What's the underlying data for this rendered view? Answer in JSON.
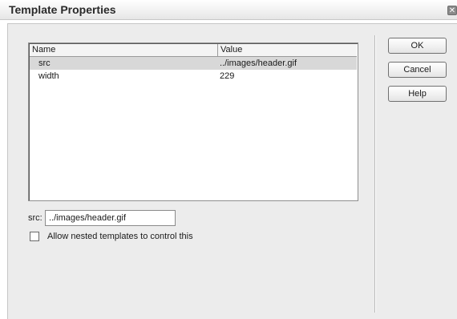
{
  "window": {
    "title": "Template Properties",
    "close_glyph": "✕"
  },
  "list": {
    "columns": [
      "Name",
      "Value"
    ],
    "rows": [
      {
        "name": "src",
        "value": "../images/header.gif",
        "selected": true
      },
      {
        "name": "width",
        "value": "229",
        "selected": false
      }
    ]
  },
  "src_field": {
    "label": "src:",
    "value": "../images/header.gif"
  },
  "nested_option": {
    "label": "Allow nested templates to control this",
    "checked": false
  },
  "buttons": {
    "ok": "OK",
    "cancel": "Cancel",
    "help": "Help"
  }
}
